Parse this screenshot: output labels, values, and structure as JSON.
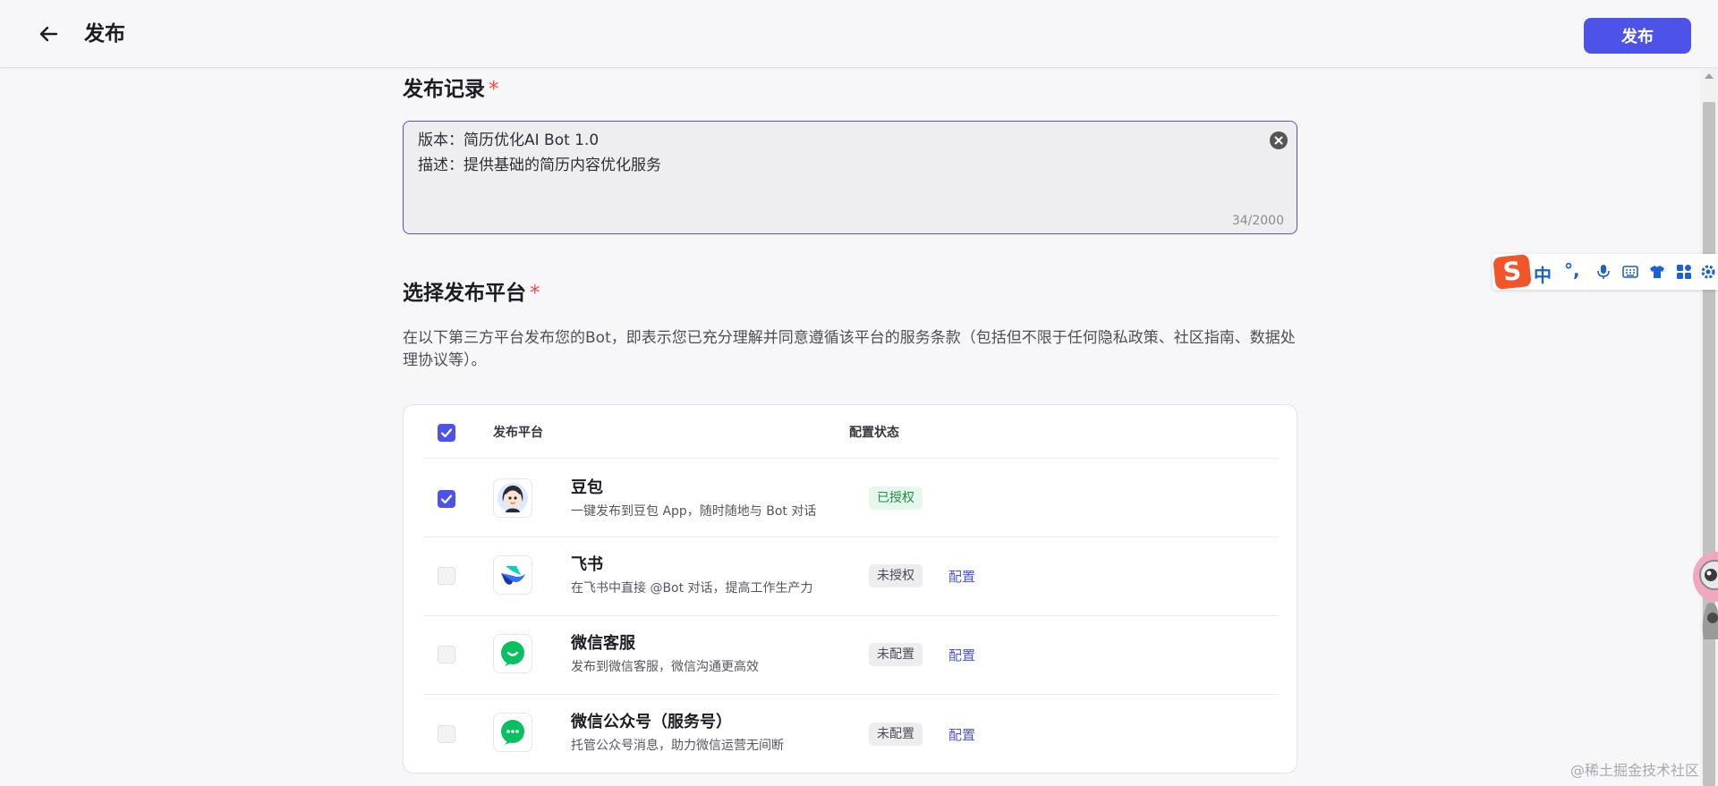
{
  "header": {
    "title": "发布",
    "publish_label": "发布"
  },
  "record": {
    "title": "发布记录",
    "required_mark": "*",
    "version_line": "版本：简历优化AI Bot 1.0",
    "desc_line": "描述：提供基础的简历内容优化服务",
    "counter": "34/2000"
  },
  "platform": {
    "title": "选择发布平台",
    "required_mark": "*",
    "description": "在以下第三方平台发布您的Bot，即表示您已充分理解并同意遵循该平台的服务条款（包括但不限于任何隐私政策、社区指南、数据处理协议等）。",
    "col_platform": "发布平台",
    "col_status": "配置状态",
    "rows": [
      {
        "name": "豆包",
        "desc": "一键发布到豆包 App，随时随地与 Bot 对话",
        "status": "已授权",
        "link": ""
      },
      {
        "name": "飞书",
        "desc": "在飞书中直接 @Bot 对话，提高工作生产力",
        "status": "未授权",
        "link": "配置"
      },
      {
        "name": "微信客服",
        "desc": "发布到微信客服，微信沟通更高效",
        "status": "未配置",
        "link": "配置"
      },
      {
        "name": "微信公众号（服务号）",
        "desc": "托管公众号消息，助力微信运营无间断",
        "status": "未配置",
        "link": "配置"
      }
    ]
  },
  "ime": {
    "logo": "S",
    "mode": "中",
    "punct": "°,"
  },
  "watermark": "@稀土掘金技术社区",
  "colors": {
    "accent": "#4d53e8",
    "authorized_bg": "#e6f7ec",
    "authorized_text": "#1e8c47"
  }
}
